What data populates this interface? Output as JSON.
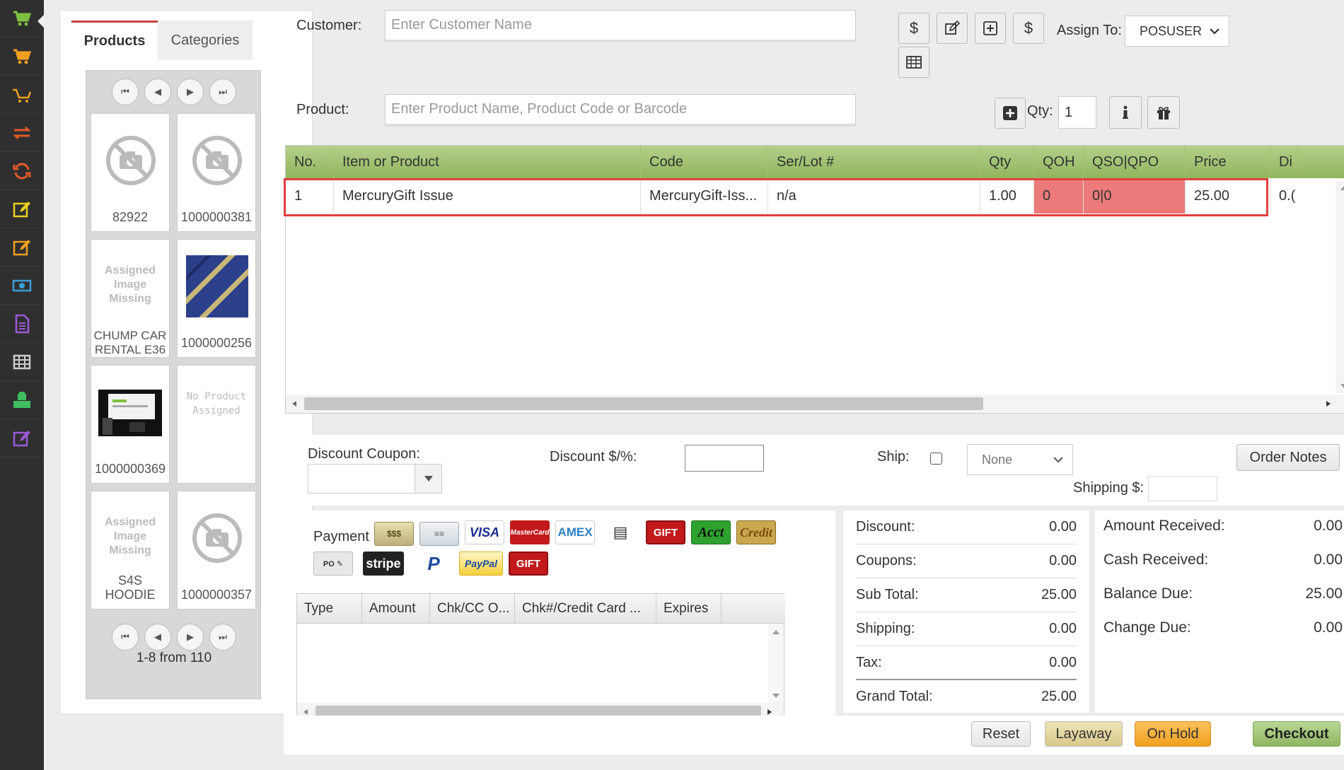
{
  "sidebar": {
    "items": [
      {
        "icon": "cart-icon",
        "color": "#7fbf3f"
      },
      {
        "icon": "cart-orange-icon",
        "color": "#f0a020"
      },
      {
        "icon": "cart-outline-icon",
        "color": "#f0a020"
      },
      {
        "icon": "transfer-icon",
        "color": "#e05a2a"
      },
      {
        "icon": "refresh-icon",
        "color": "#e05a2a"
      },
      {
        "icon": "edit-yellow-icon",
        "color": "#e8d020"
      },
      {
        "icon": "edit-orange-icon",
        "color": "#f0a020"
      },
      {
        "icon": "cash-icon",
        "color": "#3a9ed8"
      },
      {
        "icon": "document-icon",
        "color": "#9b5ad8"
      },
      {
        "icon": "table-icon",
        "color": "#cccccc"
      },
      {
        "icon": "register-icon",
        "color": "#3fbf5f"
      },
      {
        "icon": "edit-purple-icon",
        "color": "#9b5ad8"
      }
    ]
  },
  "products_panel": {
    "tab_products": "Products",
    "tab_categories": "Categories",
    "items": [
      {
        "caption": "82922",
        "image": "no-camera"
      },
      {
        "caption": "1000000381",
        "image": "no-camera"
      },
      {
        "caption": "CHUMP CAR RENTAL E36",
        "image": "assigned-missing",
        "missing_text": "Assigned Image Missing"
      },
      {
        "caption": "1000000256",
        "image": "photo-stripes"
      },
      {
        "caption": "1000000369",
        "image": "photo-screen"
      },
      {
        "caption": "",
        "image": "no-product",
        "missing_text": "No Product Assigned"
      },
      {
        "caption": "S4S HOODIE",
        "image": "assigned-missing",
        "missing_text": "Assigned Image Missing"
      },
      {
        "caption": "1000000357",
        "image": "no-camera"
      }
    ],
    "footer": "1-8 from 110"
  },
  "customer": {
    "label": "Customer:",
    "placeholder": "Enter Customer Name"
  },
  "assign_to": {
    "label": "Assign To:",
    "value": "POSUSER"
  },
  "product": {
    "label": "Product:",
    "placeholder": "Enter Product Name, Product Code or Barcode",
    "qty_label": "Qty:",
    "qty_value": "1"
  },
  "order_table": {
    "headers": [
      "No.",
      "Item or Product",
      "Code",
      "Ser/Lot #",
      "Qty",
      "QOH",
      "QSO|QPO",
      "Price",
      "Di"
    ],
    "rows": [
      [
        "1",
        "MercuryGift Issue",
        "MercuryGift-Iss...",
        "n/a",
        "1.00",
        "0",
        "0|0",
        "25.00",
        "0.("
      ]
    ]
  },
  "discount": {
    "coupon_label": "Discount Coupon:",
    "discount_label": "Discount $/%:",
    "ship_label": "Ship:",
    "ship_method": "None",
    "shipping_label": "Shipping $:",
    "order_notes": "Order Notes"
  },
  "payment": {
    "label": "Payment",
    "methods": [
      "Cash",
      "Check",
      "VISA",
      "MasterCard",
      "AMEX",
      "Card",
      "GIFT",
      "Acct",
      "Credit",
      "PO",
      "stripe",
      "P",
      "PayPal",
      "GIFT"
    ],
    "columns": [
      "Type",
      "Amount",
      "Chk/CC O...",
      "Chk#/Credit Card ...",
      "Expires"
    ]
  },
  "totals": [
    {
      "label": "Discount:",
      "value": "0.00"
    },
    {
      "label": "Coupons:",
      "value": "0.00"
    },
    {
      "label": "Sub Total:",
      "value": "25.00"
    },
    {
      "label": "Shipping:",
      "value": "0.00"
    },
    {
      "label": "Tax:",
      "value": "0.00"
    },
    {
      "label": "Grand Total:",
      "value": "25.00"
    }
  ],
  "amounts": [
    {
      "label": "Amount Received:",
      "value": "0.00"
    },
    {
      "label": "Cash Received:",
      "value": "0.00"
    },
    {
      "label": "Balance Due:",
      "value": "25.00"
    },
    {
      "label": "Change Due:",
      "value": "0.00"
    }
  ],
  "actions": {
    "reset": "Reset",
    "layaway": "Layaway",
    "on_hold": "On Hold",
    "checkout": "Checkout"
  }
}
